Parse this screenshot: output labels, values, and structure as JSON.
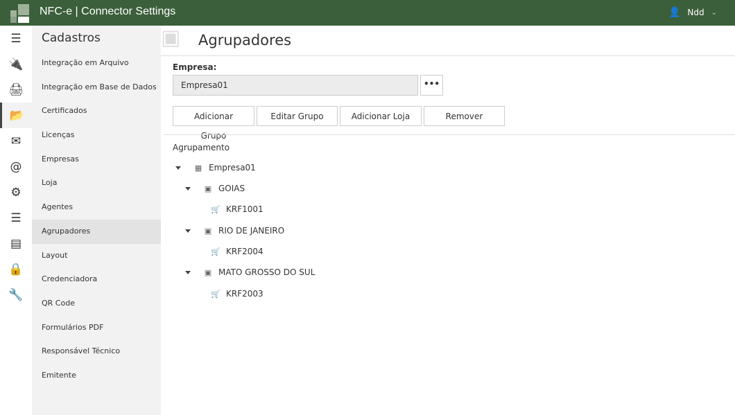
{
  "header": {
    "title": "NFC-e | Connector Settings",
    "user": "Ndd"
  },
  "rail": [
    "menu-icon",
    "plug-icon",
    "print-icon",
    "folder-open-icon",
    "envelope-icon",
    "at-icon",
    "gear-icon",
    "sliders-icon",
    "server-icon",
    "lock-icon",
    "wrench-icon"
  ],
  "menu": {
    "title": "Cadastros",
    "items": [
      "Integração em Arquivo",
      "Integração em Base de Dados",
      "Certificados",
      "Licenças",
      "Empresas",
      "Loja",
      "Agentes",
      "Agrupadores",
      "Layout",
      "Credenciadora",
      "QR Code",
      "Formulários PDF",
      "Responsável Técnico",
      "Emitente"
    ]
  },
  "page": {
    "title": "Agrupadores",
    "empresa_label": "Empresa:",
    "empresa_value": "Empresa01",
    "browse": "•••",
    "buttons": [
      "Adicionar Grupo",
      "Editar Grupo",
      "Adicionar Loja",
      "Remover"
    ],
    "tree_label": "Agrupamento",
    "tree": {
      "root": "Empresa01",
      "groups": [
        {
          "name": "GOIAS",
          "stores": [
            "KRF1001"
          ]
        },
        {
          "name": "RIO DE JANEIRO",
          "stores": [
            "KRF2004"
          ]
        },
        {
          "name": "MATO GROSSO DO SUL",
          "stores": [
            "KRF2003"
          ]
        }
      ]
    }
  }
}
